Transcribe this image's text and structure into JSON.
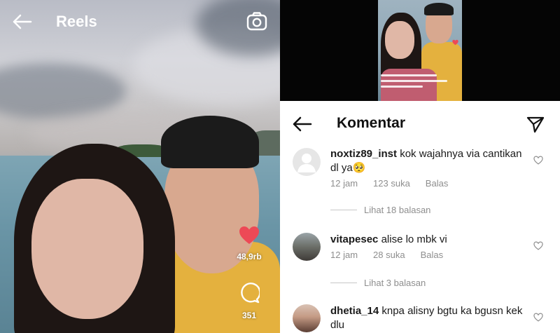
{
  "reels": {
    "title": "Reels",
    "like_count": "48,9rb",
    "comment_count": "351",
    "heart_color": "#ed4956"
  },
  "comments_panel": {
    "title": "Komentar",
    "comments": [
      {
        "username": "noxtiz89_inst",
        "text": "kok wajahnya via cantikan dl ya🥺",
        "time": "12 jam",
        "likes": "123 suka",
        "reply_label": "Balas",
        "view_replies": "Lihat 18 balasan"
      },
      {
        "username": "vitapesec",
        "text": "alise lo mbk vi",
        "time": "12 jam",
        "likes": "28 suka",
        "reply_label": "Balas",
        "view_replies": "Lihat 3 balasan"
      },
      {
        "username": "dhetia_14",
        "text": "knpa alisny bgtu ka bgusn kek dlu"
      }
    ]
  }
}
